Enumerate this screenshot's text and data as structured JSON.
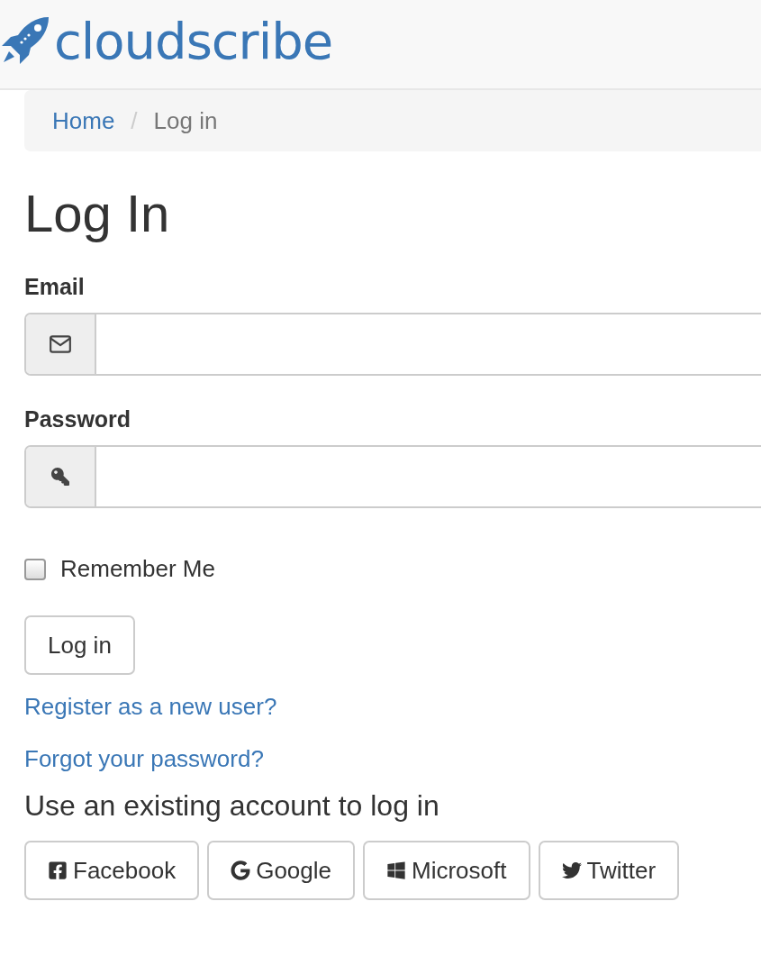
{
  "brand": {
    "name": "cloudscribe"
  },
  "breadcrumb_separator": "/",
  "breadcrumb": [
    {
      "label": "Home",
      "kind": "link"
    },
    {
      "label": "Log in",
      "kind": "current"
    }
  ],
  "heading": "Log In",
  "fields": [
    {
      "label": "Email",
      "kind": "email"
    },
    {
      "label": "Password",
      "kind": "password"
    }
  ],
  "remember": {
    "label": "Remember Me",
    "checked": false
  },
  "submit": "Log in",
  "links": [
    "Register as a new user?",
    "Forgot your password?"
  ],
  "external": {
    "title": "Use an existing account to log in",
    "providers": [
      {
        "label": "Facebook",
        "kind": "facebook"
      },
      {
        "label": "Google",
        "kind": "google"
      },
      {
        "label": "Microsoft",
        "kind": "microsoft"
      },
      {
        "label": "Twitter",
        "kind": "twitter"
      }
    ]
  }
}
